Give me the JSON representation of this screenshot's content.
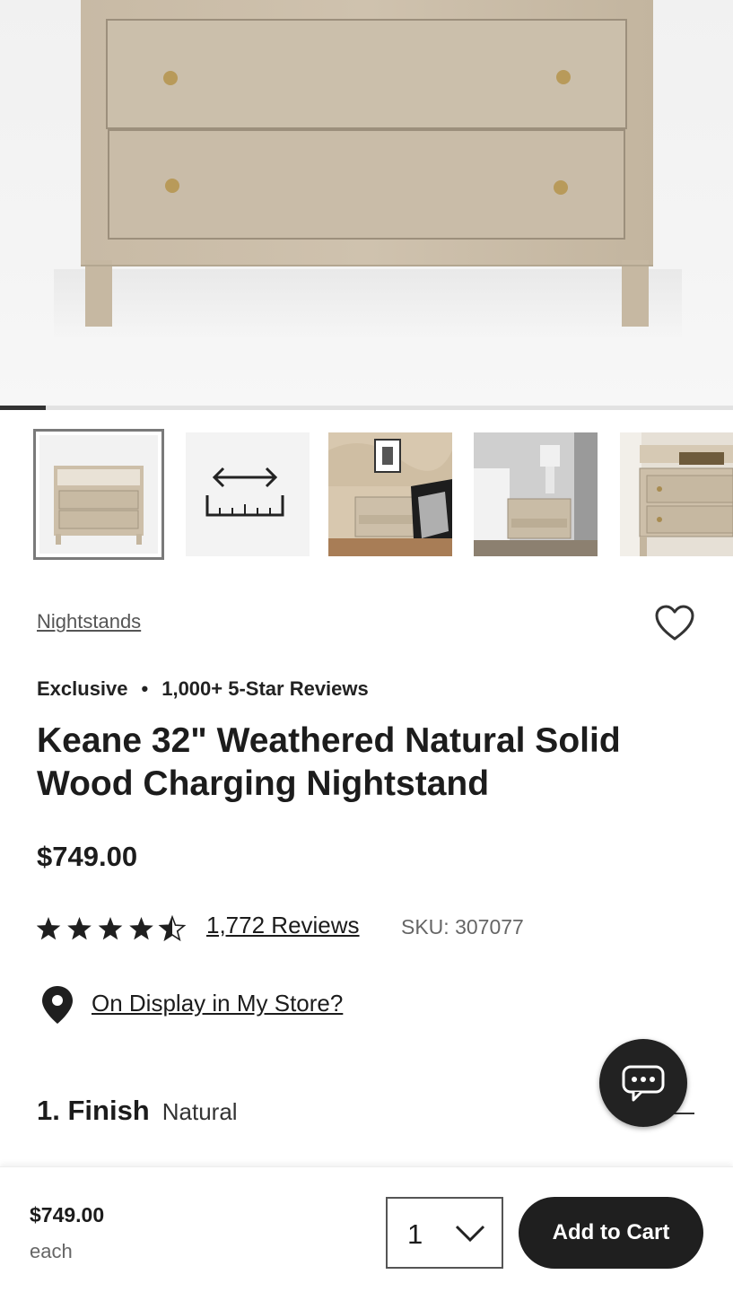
{
  "gallery": {
    "current_index": 1,
    "total_images": 16,
    "thumbnails": [
      {
        "name": "nightstand-front-thumbnail",
        "selected": true
      },
      {
        "name": "dimensions-thumbnail",
        "selected": false
      },
      {
        "name": "bedroom-scene-1-thumbnail",
        "selected": false
      },
      {
        "name": "bedroom-scene-2-thumbnail",
        "selected": false
      },
      {
        "name": "nightstand-angle-thumbnail",
        "selected": false
      }
    ]
  },
  "breadcrumb": {
    "label": "Nightstands"
  },
  "tags": {
    "exclusive": "Exclusive",
    "separator": "•",
    "reviews_badge": "1,000+ 5-Star Reviews"
  },
  "product": {
    "title": "Keane 32\" Weathered Natural Solid Wood Charging Nightstand",
    "price": "$749.00",
    "rating": 4.5,
    "rating_max": 5,
    "reviews_link": "1,772 Reviews",
    "sku": "SKU: 307077"
  },
  "store": {
    "link": "On Display in My Store?"
  },
  "finish": {
    "label": "1. Finish",
    "value": "Natural"
  },
  "bottom_bar": {
    "price": "$749.00",
    "each": "each",
    "quantity": "1",
    "add_to_cart": "Add to Cart"
  },
  "colors": {
    "accent": "#1f1f1f",
    "wood": "#c9bba6",
    "link": "#555555"
  }
}
